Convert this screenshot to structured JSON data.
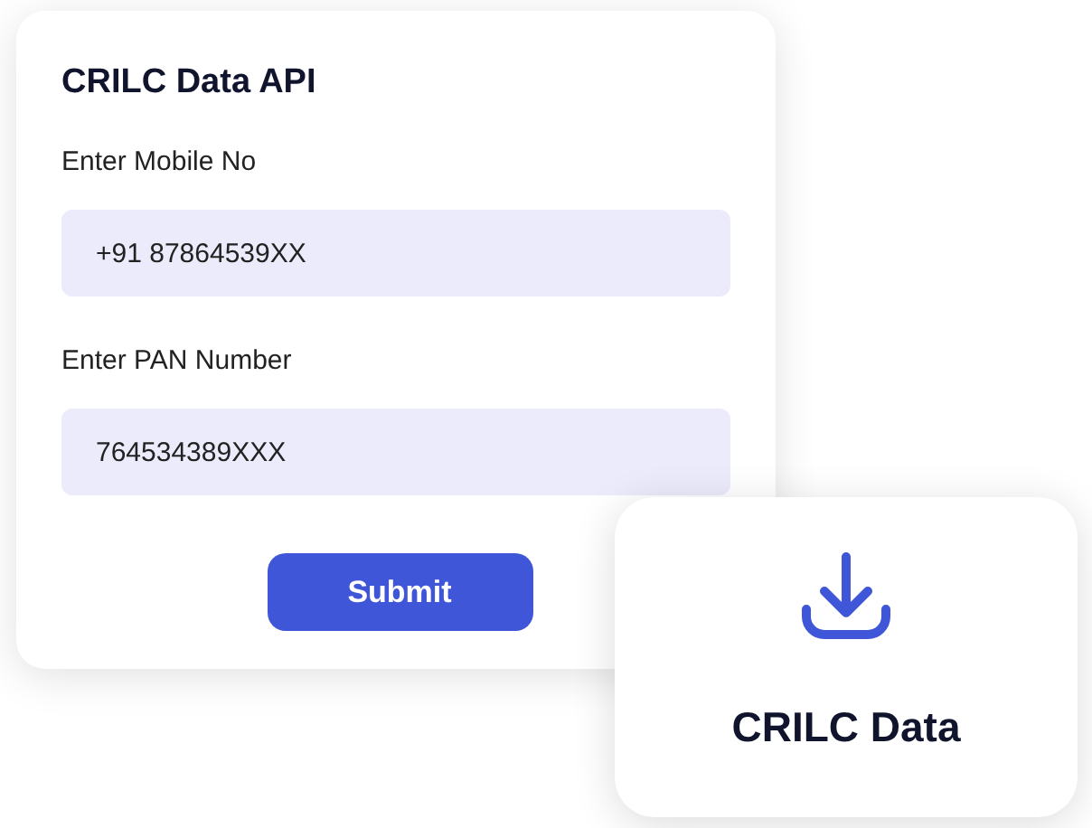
{
  "form_card": {
    "title": "CRILC Data API",
    "fields": [
      {
        "label": "Enter Mobile No",
        "value": "+91 87864539XX"
      },
      {
        "label": "Enter PAN Number",
        "value": "764534389XXX"
      }
    ],
    "submit_button": "Submit"
  },
  "download_card": {
    "label": "CRILC Data"
  }
}
